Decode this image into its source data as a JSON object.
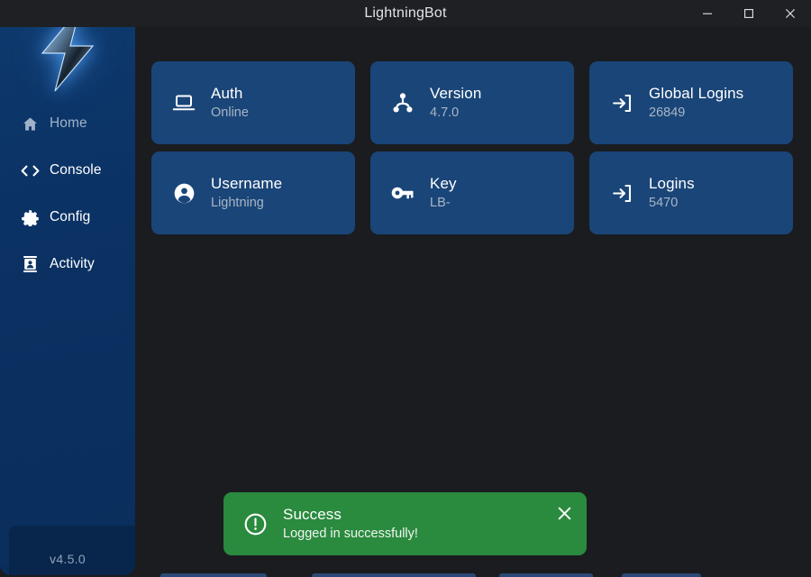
{
  "window": {
    "title": "LightningBot",
    "controls": {
      "minimize_label": "Minimize",
      "maximize_label": "Maximize",
      "close_label": "Close"
    }
  },
  "sidebar": {
    "logo_icon": "lightning-bolt-icon",
    "items": [
      {
        "label": "Home",
        "icon": "home-icon",
        "active": true
      },
      {
        "label": "Console",
        "icon": "code-icon",
        "active": false
      },
      {
        "label": "Config",
        "icon": "gear-icon",
        "active": false
      },
      {
        "label": "Activity",
        "icon": "activity-icon",
        "active": false
      }
    ],
    "version": "v4.5.0"
  },
  "main": {
    "cards": [
      {
        "title": "Auth",
        "value": "Online",
        "icon": "laptop-icon"
      },
      {
        "title": "Version",
        "value": "4.7.0",
        "icon": "sitemap-icon"
      },
      {
        "title": "Global Logins",
        "value": "26849",
        "icon": "login-arrow-icon"
      },
      {
        "title": "Username",
        "value": "Lightning",
        "icon": "user-circle-icon"
      },
      {
        "title": "Key",
        "value": "LB-",
        "icon": "key-icon"
      },
      {
        "title": "Logins",
        "value": "5470",
        "icon": "login-arrow-icon"
      }
    ]
  },
  "toast": {
    "title": "Success",
    "message": "Logged in successfully!",
    "icon": "exclamation-circle-icon",
    "close_label": "Close notification"
  },
  "colors": {
    "app_background": "#1a1c20",
    "titlebar": "#1e2024",
    "sidebar_top": "#0e3a6e",
    "sidebar_bottom": "#0a2e5c",
    "card": "#1a4578",
    "card_title": "#ffffff",
    "card_value": "#a8b6c6",
    "toast_success": "#2a8a3e",
    "nav_active": "#9fb2c9"
  }
}
